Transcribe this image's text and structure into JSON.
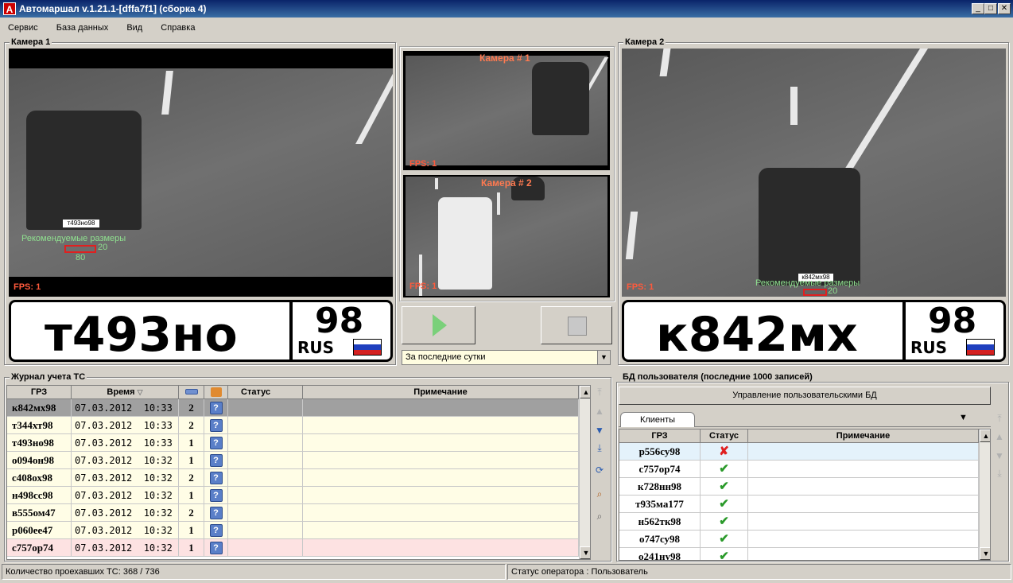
{
  "window": {
    "title": "Автомаршал v.1.21.1-[dffa7f1] (сборка 4)",
    "icon_letter": "A",
    "min": "_",
    "max": "□",
    "close": "✕"
  },
  "menu": [
    "Сервис",
    "База данных",
    "Вид",
    "Справка"
  ],
  "camera1": {
    "label": "Камера 1",
    "fps": "FPS: 1",
    "rec_label": "Рекомендуемые размеры",
    "rec_w": "80",
    "rec_h": "20",
    "small_plate": "т493но98",
    "plate_main": "т493но",
    "plate_region": "98",
    "plate_country": "RUS"
  },
  "camera2": {
    "label": "Камера 2",
    "fps": "FPS: 1",
    "rec_label": "Рекомендуемые размеры",
    "rec_h": "20",
    "small_plate": "к842мх98",
    "plate_main": "к842мх",
    "plate_region": "98",
    "plate_country": "RUS"
  },
  "preview": {
    "cam1_title": "Камера # 1",
    "cam1_fps": "FPS: 1",
    "cam2_title": "Камера # 2",
    "cam2_fps": "FPS: 1",
    "period": "За последние сутки"
  },
  "flag_colors": [
    "#ffffff",
    "#1f3fbf",
    "#d42020"
  ],
  "log": {
    "label": "Журнал учета ТС",
    "columns": [
      "ГРЗ",
      "Время",
      "",
      "",
      "Статус",
      "Примечание"
    ],
    "rows": [
      {
        "grz": "к842мх98",
        "time": "07.03.2012  10:33",
        "count": "2",
        "bg": "#a0a0a0"
      },
      {
        "grz": "т344хт98",
        "time": "07.03.2012  10:33",
        "count": "2",
        "bg": "#fffde6"
      },
      {
        "grz": "т493но98",
        "time": "07.03.2012  10:33",
        "count": "1",
        "bg": "#fffde6"
      },
      {
        "grz": "о094он98",
        "time": "07.03.2012  10:32",
        "count": "1",
        "bg": "#fffde6"
      },
      {
        "grz": "с408ох98",
        "time": "07.03.2012  10:32",
        "count": "2",
        "bg": "#fffde6"
      },
      {
        "grz": "н498сс98",
        "time": "07.03.2012  10:32",
        "count": "1",
        "bg": "#fffde6"
      },
      {
        "grz": "в555ом47",
        "time": "07.03.2012  10:32",
        "count": "2",
        "bg": "#fffde6"
      },
      {
        "grz": "р060ее47",
        "time": "07.03.2012  10:32",
        "count": "1",
        "bg": "#fffde6"
      },
      {
        "grz": "с757ор74",
        "time": "07.03.2012  10:32",
        "count": "1",
        "bg": "#fde2e2"
      }
    ]
  },
  "db": {
    "label": "БД пользователя (последние 1000 записей)",
    "manage_btn": "Управление пользовательскими БД",
    "tab": "Клиенты",
    "columns": [
      "ГРЗ",
      "Статус",
      "Примечание"
    ],
    "rows": [
      {
        "grz": "р556су98",
        "status": "denied",
        "bg": "#e4f2fb"
      },
      {
        "grz": "с757ор74",
        "status": "allowed",
        "bg": "#ffffff"
      },
      {
        "grz": "к728нн98",
        "status": "allowed",
        "bg": "#ffffff"
      },
      {
        "grz": "т935ма177",
        "status": "allowed",
        "bg": "#ffffff"
      },
      {
        "grz": "н562тк98",
        "status": "allowed",
        "bg": "#ffffff"
      },
      {
        "grz": "о747су98",
        "status": "allowed",
        "bg": "#ffffff"
      },
      {
        "grz": "о241ну98",
        "status": "allowed",
        "bg": "#ffffff"
      }
    ]
  },
  "statusbar": {
    "count": "Количество проехавших ТС: 368 / 736",
    "operator": "Статус оператора : Пользователь"
  }
}
